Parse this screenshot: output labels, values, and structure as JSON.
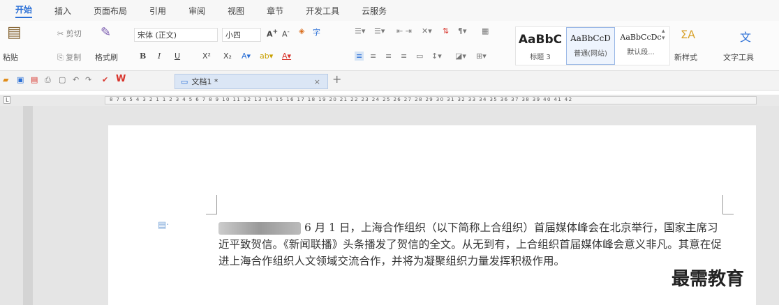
{
  "menu": {
    "tabs": [
      "开始",
      "插入",
      "页面布局",
      "引用",
      "审阅",
      "视图",
      "章节",
      "开发工具",
      "云服务"
    ]
  },
  "toolbar": {
    "paste_label": "粘贴",
    "cut_label": "剪切",
    "copy_label": "复制",
    "format_painter_label": "格式刷",
    "font_name": "宋体 (正文)",
    "font_size": "小四",
    "bold": "B",
    "italic": "I",
    "underline": "U",
    "superscript": "X²",
    "subscript": "X₂",
    "new_style_label": "新样式",
    "text_tool_label": "文字工具"
  },
  "styles": [
    {
      "preview": "AaBbC",
      "caption": "标题 3"
    },
    {
      "preview": "AaBbCcD",
      "caption": "普通(网站)"
    },
    {
      "preview": "AaBbCcDc",
      "caption": "默认段..."
    }
  ],
  "document_tab": {
    "title": "文档1 *",
    "close": "×",
    "add": "+"
  },
  "ruler": {
    "numbers": "8 7 6 5 4 3 2 1   1 2 3 4 5 6 7 8 9 10 11 12 13 14 15 16 17 18 19 20 21 22 23 24 25 26 27 28 29 30 31 32 33 34 35 36 37 38 39 40 41 42"
  },
  "document": {
    "lead": "6 月 1 日，上海合作组织（以下简称上合组织）首届媒体峰会在北",
    "body": "京举行，国家主席习近平致贺信。《新闻联播》头条播发了贺信的全文。从无到有，上合组织首届媒体峰会意义非凡。其意在促进上海合作组织人文领域交流合作，并将为凝聚组织力量发挥积极作用。"
  },
  "watermark": "最需教育",
  "colors": {
    "accent": "#2a6fd6",
    "format_red": "#d8342c"
  }
}
